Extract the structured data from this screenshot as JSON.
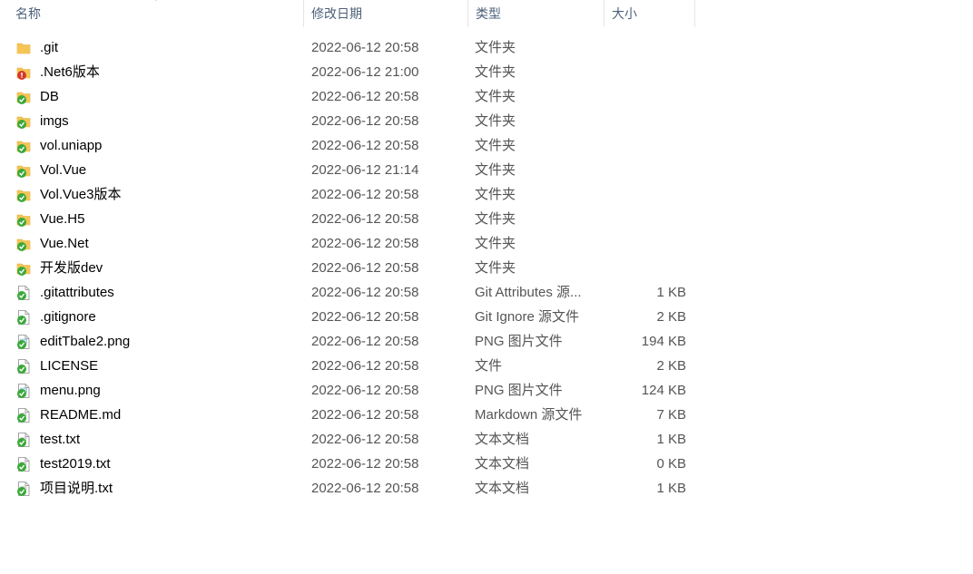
{
  "header": {
    "name_label": "名称",
    "date_label": "修改日期",
    "type_label": "类型",
    "size_label": "大小"
  },
  "colors": {
    "folder": "#f4c555",
    "folder_dark": "#e1a93a",
    "sync_ok": "#3aa93a",
    "sync_error": "#d23a2a",
    "header_text": "#4c607a"
  },
  "rows": [
    {
      "name": ".git",
      "date": "2022-06-12 20:58",
      "type": "文件夹",
      "size": "",
      "kind": "folder",
      "status": "none",
      "icon": "folder-icon"
    },
    {
      "name": ".Net6版本",
      "date": "2022-06-12 21:00",
      "type": "文件夹",
      "size": "",
      "kind": "folder",
      "status": "error",
      "icon": "folder-conflict-icon"
    },
    {
      "name": "DB",
      "date": "2022-06-12 20:58",
      "type": "文件夹",
      "size": "",
      "kind": "folder",
      "status": "ok",
      "icon": "folder-synced-icon"
    },
    {
      "name": "imgs",
      "date": "2022-06-12 20:58",
      "type": "文件夹",
      "size": "",
      "kind": "folder",
      "status": "ok",
      "icon": "folder-synced-icon"
    },
    {
      "name": "vol.uniapp",
      "date": "2022-06-12 20:58",
      "type": "文件夹",
      "size": "",
      "kind": "folder",
      "status": "ok",
      "icon": "folder-synced-icon"
    },
    {
      "name": "Vol.Vue",
      "date": "2022-06-12 21:14",
      "type": "文件夹",
      "size": "",
      "kind": "folder",
      "status": "ok",
      "icon": "folder-synced-icon"
    },
    {
      "name": "Vol.Vue3版本",
      "date": "2022-06-12 20:58",
      "type": "文件夹",
      "size": "",
      "kind": "folder",
      "status": "ok",
      "icon": "folder-synced-icon"
    },
    {
      "name": "Vue.H5",
      "date": "2022-06-12 20:58",
      "type": "文件夹",
      "size": "",
      "kind": "folder",
      "status": "ok",
      "icon": "folder-synced-icon"
    },
    {
      "name": "Vue.Net",
      "date": "2022-06-12 20:58",
      "type": "文件夹",
      "size": "",
      "kind": "folder",
      "status": "ok",
      "icon": "folder-synced-icon"
    },
    {
      "name": "开发版dev",
      "date": "2022-06-12 20:58",
      "type": "文件夹",
      "size": "",
      "kind": "folder",
      "status": "ok",
      "icon": "folder-synced-icon"
    },
    {
      "name": ".gitattributes",
      "date": "2022-06-12 20:58",
      "type": "Git Attributes 源...",
      "size": "1 KB",
      "kind": "file",
      "status": "ok",
      "icon": "file-synced-icon"
    },
    {
      "name": ".gitignore",
      "date": "2022-06-12 20:58",
      "type": "Git Ignore 源文件",
      "size": "2 KB",
      "kind": "file",
      "status": "ok",
      "icon": "file-synced-icon"
    },
    {
      "name": "editTbale2.png",
      "date": "2022-06-12 20:58",
      "type": "PNG 图片文件",
      "size": "194 KB",
      "kind": "image",
      "status": "ok",
      "icon": "image-synced-icon"
    },
    {
      "name": "LICENSE",
      "date": "2022-06-12 20:58",
      "type": "文件",
      "size": "2 KB",
      "kind": "file",
      "status": "ok",
      "icon": "file-synced-icon"
    },
    {
      "name": "menu.png",
      "date": "2022-06-12 20:58",
      "type": "PNG 图片文件",
      "size": "124 KB",
      "kind": "image",
      "status": "ok",
      "icon": "image-synced-icon"
    },
    {
      "name": "README.md",
      "date": "2022-06-12 20:58",
      "type": "Markdown 源文件",
      "size": "7 KB",
      "kind": "text",
      "status": "ok",
      "icon": "text-file-synced-icon"
    },
    {
      "name": "test.txt",
      "date": "2022-06-12 20:58",
      "type": "文本文档",
      "size": "1 KB",
      "kind": "text",
      "status": "ok",
      "icon": "text-file-synced-icon"
    },
    {
      "name": "test2019.txt",
      "date": "2022-06-12 20:58",
      "type": "文本文档",
      "size": "0 KB",
      "kind": "text",
      "status": "ok",
      "icon": "text-file-synced-icon"
    },
    {
      "name": "项目说明.txt",
      "date": "2022-06-12 20:58",
      "type": "文本文档",
      "size": "1 KB",
      "kind": "text",
      "status": "ok",
      "icon": "text-file-synced-icon"
    }
  ]
}
